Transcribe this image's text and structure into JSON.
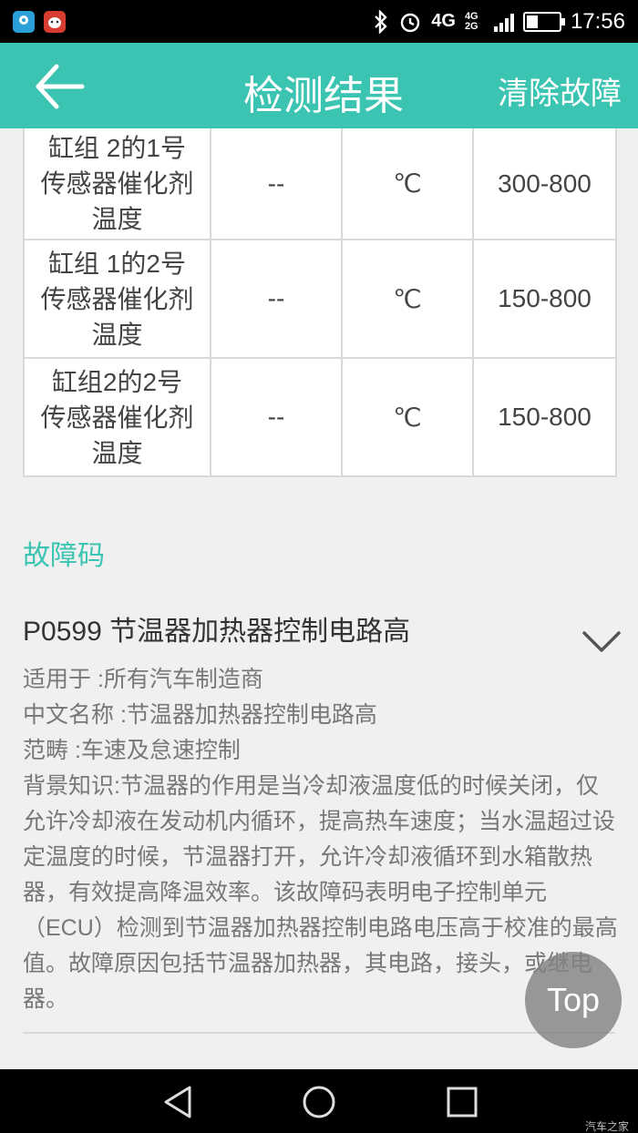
{
  "status_bar": {
    "network": "4G",
    "network_sub": "4G 2G",
    "time": "17:56",
    "icons": [
      "maps-icon",
      "cow-app-icon",
      "bluetooth-icon",
      "alarm-icon",
      "signal-icon",
      "battery-icon"
    ]
  },
  "header": {
    "back_icon": "arrow-left-icon",
    "title": "检测结果",
    "clear_label": "清除故障",
    "bg_color": "#3cc4b2"
  },
  "table": {
    "rows": [
      {
        "name_lines": [
          "缸组 2的1号",
          "传感器催化剂",
          "温度"
        ],
        "value": "--",
        "unit": "℃",
        "range": "300-800"
      },
      {
        "name_lines": [
          "缸组 1的2号",
          "传感器催化剂",
          "温度"
        ],
        "value": "--",
        "unit": "℃",
        "range": "150-800"
      },
      {
        "name_lines": [
          "缸组2的2号",
          "传感器催化剂",
          "温度"
        ],
        "value": "--",
        "unit": "℃",
        "range": "150-800"
      }
    ]
  },
  "fault": {
    "heading": "故障码",
    "code_title": "P0599 节温器加热器控制电路高",
    "expand_icon": "chevron-down-icon",
    "applies": "适用于 :所有汽车制造商",
    "cn_name": "中文名称 :节温器加热器控制电路高",
    "category": "范畴 :车速及怠速控制",
    "background": "背景知识:节温器的作用是当冷却液温度低的时候关闭，仅允许冷却液在发动机内循环，提高热车速度；当水温超过设定温度的时候，节温器打开，允许冷却液循环到水箱散热器，有效提高降温效率。该故障码表明电子控制单元（ECU）检测到节温器加热器控制电路电压高于校准的最高值。故障原因包括节温器加热器，其电路，接头，或继电器。"
  },
  "top_button": "Top",
  "nav": {
    "icons": [
      "nav-back-icon",
      "nav-home-icon",
      "nav-recent-icon"
    ]
  },
  "watermark": "汽车之家"
}
